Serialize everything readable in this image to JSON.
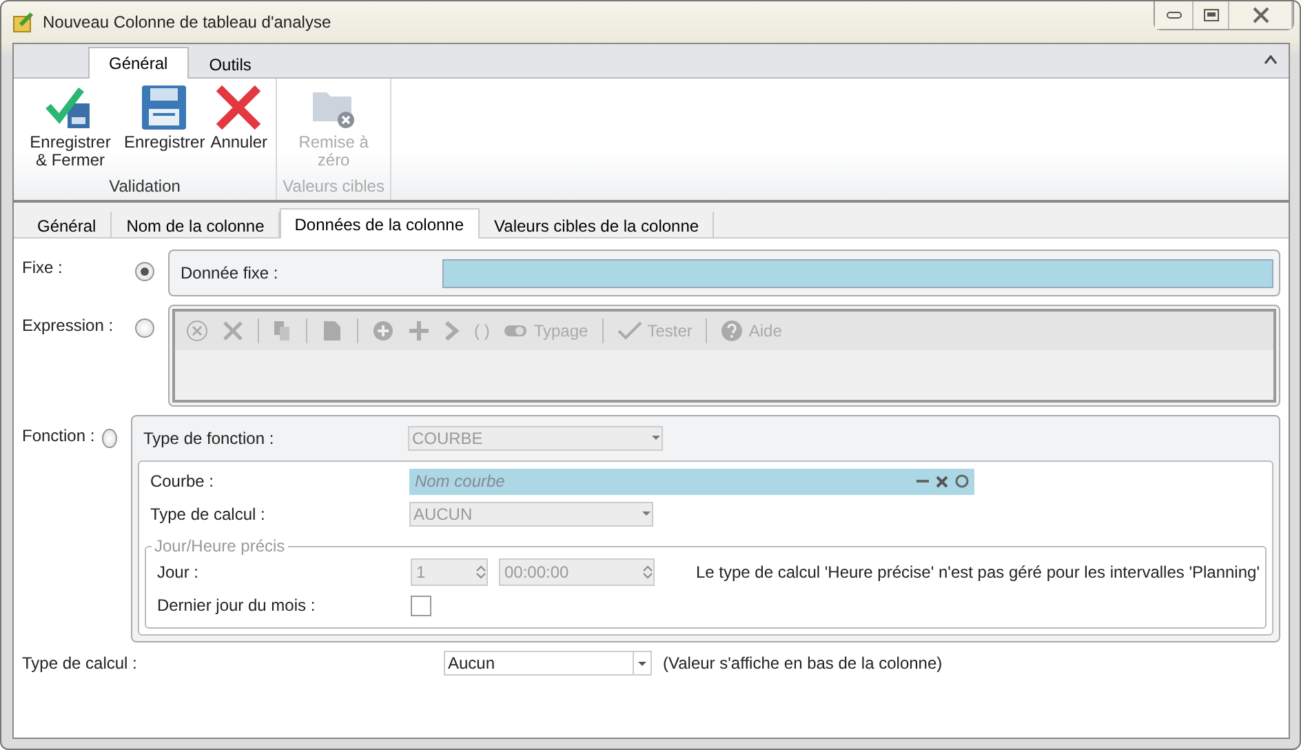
{
  "window": {
    "title": "Nouveau Colonne de tableau d'analyse"
  },
  "ribbon": {
    "tabs": [
      {
        "label": "Général",
        "selected": true
      },
      {
        "label": "Outils",
        "selected": false
      }
    ],
    "groups": [
      {
        "label": "Validation",
        "disabled": false,
        "buttons": [
          {
            "kind": "save-close",
            "label": "Enregistrer & Fermer",
            "disabled": false
          },
          {
            "kind": "save",
            "label": "Enregistrer",
            "disabled": false
          },
          {
            "kind": "cancel",
            "label": "Annuler",
            "disabled": false
          }
        ]
      },
      {
        "label": "Valeurs cibles",
        "disabled": true,
        "buttons": [
          {
            "kind": "reset",
            "label": "Remise à zéro",
            "disabled": true
          }
        ]
      }
    ]
  },
  "form_tabs": [
    {
      "label": "Général",
      "selected": false
    },
    {
      "label": "Nom de la colonne",
      "selected": false
    },
    {
      "label": "Données de la colonne",
      "selected": true
    },
    {
      "label": "Valeurs cibles de la colonne",
      "selected": false
    }
  ],
  "fixe": {
    "label": "Fixe :",
    "selected": true,
    "field_label": "Donnée fixe :"
  },
  "expression": {
    "label": "Expression :",
    "selected": false,
    "toolbar": [
      {
        "kind": "clear"
      },
      {
        "kind": "delete"
      },
      {
        "kind": "separator"
      },
      {
        "kind": "copy"
      },
      {
        "kind": "separator"
      },
      {
        "kind": "paste"
      },
      {
        "kind": "separator"
      },
      {
        "kind": "add"
      },
      {
        "kind": "plus"
      },
      {
        "kind": "next"
      },
      {
        "kind": "text",
        "label": "( )"
      },
      {
        "kind": "typage",
        "label": "Typage"
      },
      {
        "kind": "separator"
      },
      {
        "kind": "test",
        "label": "Tester"
      },
      {
        "kind": "separator"
      },
      {
        "kind": "help",
        "label": "Aide"
      }
    ]
  },
  "fonction": {
    "label": "Fonction :",
    "selected": false,
    "type_label": "Type de fonction :",
    "type_value": "COURBE",
    "courbe_label": "Courbe :",
    "courbe_placeholder": "Nom courbe",
    "calc_label": "Type de calcul :",
    "calc_value": "AUCUN",
    "group_title": "Jour/Heure précis",
    "jour_label": "Jour :",
    "jour_value": "1",
    "heure_value": "00:00:00",
    "message": "Le type de calcul 'Heure précise' n'est pas géré pour les intervalles 'Planning'",
    "last_day_label": "Dernier jour du mois :",
    "last_day_checked": false
  },
  "bottom": {
    "label": "Type de calcul :",
    "value": "Aucun",
    "note": "(Valeur s'affiche en bas de la colonne)"
  }
}
